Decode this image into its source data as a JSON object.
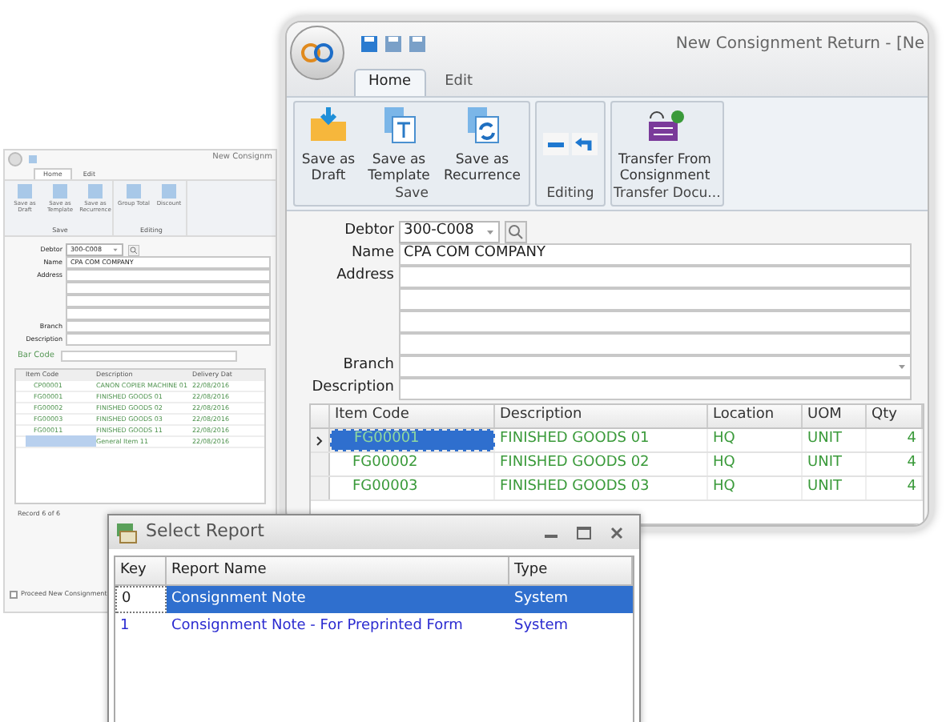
{
  "back_window": {
    "title": "New Consignm",
    "tabs": [
      {
        "label": "Home",
        "selected": true
      },
      {
        "label": "Edit",
        "selected": false
      }
    ],
    "ribbon_groups": [
      {
        "label": "Save",
        "buttons": [
          "Save as Draft",
          "Save as Template",
          "Save as Recurrence"
        ]
      },
      {
        "label": "Editing",
        "buttons": [
          "Group Total",
          "Discount"
        ]
      }
    ],
    "fields": [
      {
        "label": "Debtor",
        "value": "300-C008",
        "kind": "lookup"
      },
      {
        "label": "Name",
        "value": "CPA COM COMPANY",
        "kind": "text"
      },
      {
        "label": "Address",
        "kind": "text"
      },
      {
        "kind": "text"
      },
      {
        "kind": "text"
      },
      {
        "kind": "text"
      },
      {
        "label": "Branch",
        "kind": "text"
      },
      {
        "label": "Description",
        "kind": "text"
      }
    ],
    "bar_code_label": "Bar Code",
    "columns": [
      "Item Code",
      "Description",
      "Delivery Dat"
    ],
    "rows": [
      {
        "cells": [
          "CP00001",
          "CANON COPIER MACHINE 01",
          "22/08/2016"
        ],
        "selected": false
      },
      {
        "cells": [
          "FG00001",
          "FINISHED GOODS 01",
          "22/08/2016"
        ],
        "selected": false
      },
      {
        "cells": [
          "FG00002",
          "FINISHED GOODS 02",
          "22/08/2016"
        ],
        "selected": false
      },
      {
        "cells": [
          "FG00003",
          "FINISHED GOODS 03",
          "22/08/2016"
        ],
        "selected": false
      },
      {
        "cells": [
          "FG00011",
          "FINISHED GOODS 11",
          "22/08/2016"
        ],
        "selected": false
      },
      {
        "cells": [
          "",
          "General Item 11",
          "22/08/2016"
        ],
        "selected": true
      }
    ],
    "record_nav": "Record 6 of 6",
    "proceed": {
      "label": "Proceed New Consignment",
      "checked": false
    }
  },
  "main_window": {
    "title": "New Consignment Return - [Ne",
    "tabs": [
      {
        "label": "Home",
        "selected": true
      },
      {
        "label": "Edit",
        "selected": false
      }
    ],
    "ribbon_groups": [
      {
        "label": "Save",
        "buttons": [
          {
            "label": "Save as Draft",
            "kind": "draft"
          },
          {
            "label": "Save as Template",
            "kind": "template"
          },
          {
            "label": "Save as Recurrence",
            "kind": "recurrence"
          }
        ]
      },
      {
        "label": "Editing",
        "buttons": [
          {
            "kind": "editing"
          }
        ]
      },
      {
        "label": "Transfer Docu...",
        "buttons": [
          {
            "label": "Transfer From Consignment",
            "kind": "transfer"
          }
        ]
      }
    ],
    "fields": [
      {
        "label": "Debtor",
        "value": "300-C008",
        "kind": "lookup"
      },
      {
        "label": "Name",
        "value": "CPA COM COMPANY",
        "kind": "text"
      },
      {
        "label": "Address",
        "kind": "text"
      },
      {
        "kind": "text"
      },
      {
        "kind": "text"
      },
      {
        "kind": "text"
      },
      {
        "label": "Branch",
        "kind": "dropdown"
      },
      {
        "label": "Description",
        "kind": "text"
      }
    ],
    "grid": {
      "columns": [
        "Item Code",
        "Description",
        "Location",
        "UOM",
        "Qty"
      ],
      "rows": [
        {
          "item_code": "FG00001",
          "description": "FINISHED GOODS 01",
          "location": "HQ",
          "uom": "UNIT",
          "qty": "4",
          "selected": true
        },
        {
          "item_code": "FG00002",
          "description": "FINISHED GOODS 02",
          "location": "HQ",
          "uom": "UNIT",
          "qty": "4",
          "selected": false
        },
        {
          "item_code": "FG00003",
          "description": "FINISHED GOODS 03",
          "location": "HQ",
          "uom": "UNIT",
          "qty": "4",
          "selected": false
        }
      ]
    }
  },
  "dialog": {
    "title": "Select Report",
    "columns": [
      "Key",
      "Report Name",
      "Type"
    ],
    "rows": [
      {
        "key": "0",
        "name": "Consignment Note",
        "type": "System",
        "selected": true
      },
      {
        "key": "1",
        "name": "Consignment Note - For Preprinted Form",
        "type": "System",
        "selected": false
      }
    ]
  }
}
